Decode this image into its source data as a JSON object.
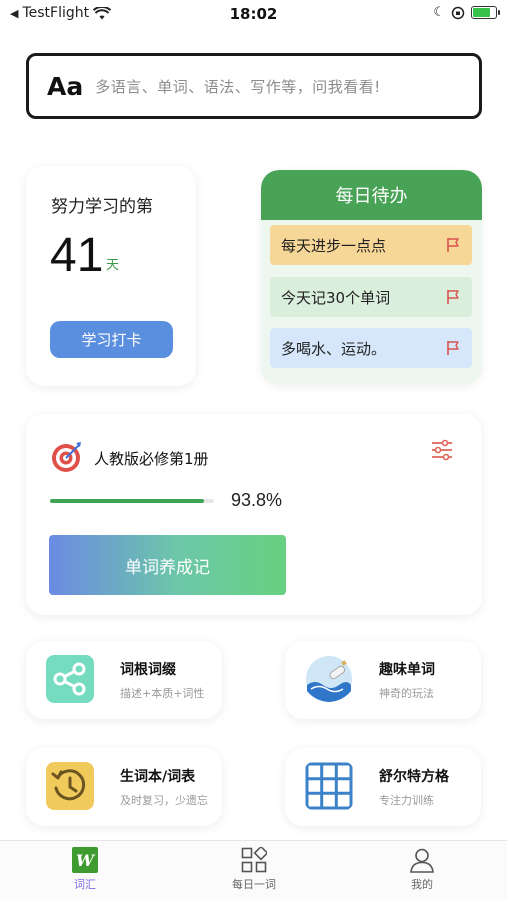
{
  "status_bar": {
    "back_app": "TestFlight",
    "time": "18:02"
  },
  "search": {
    "icon_text": "Aa",
    "placeholder": "多语言、单词、语法、写作等，问我看看!"
  },
  "study": {
    "title": "努力学习的第",
    "days": "41",
    "unit": "天",
    "checkin_label": "学习打卡"
  },
  "todo": {
    "title": "每日待办",
    "items": [
      {
        "label": "每天进步一点点"
      },
      {
        "label": "今天记30个单词"
      },
      {
        "label": "多喝水、运动。"
      }
    ],
    "colors": {
      "item1": "#f6d797",
      "item2": "#daeedc",
      "item3": "#d6e6fb",
      "header": "#49a356"
    }
  },
  "book": {
    "title": "人教版必修第1册",
    "progress": 0.938,
    "progress_label": "93.8%",
    "action_label": "单词养成记"
  },
  "features": [
    {
      "title": "词根词缀",
      "subtitle": "描述+本质+词性",
      "icon": "share-icon"
    },
    {
      "title": "趣味单词",
      "subtitle": "神奇的玩法",
      "icon": "bottle-wave-icon"
    },
    {
      "title": "生词本/词表",
      "subtitle": "及时复习，少遗忘",
      "icon": "history-icon"
    },
    {
      "title": "舒尔特方格",
      "subtitle": "专注力训练",
      "icon": "grid-icon"
    }
  ],
  "tabs": [
    {
      "label": "词汇",
      "active": true,
      "icon": "w-logo-icon"
    },
    {
      "label": "每日一词",
      "active": false,
      "icon": "apps-icon"
    },
    {
      "label": "我的",
      "active": false,
      "icon": "user-icon"
    }
  ],
  "colors": {
    "accent_blue": "#5a8fdf",
    "accent_green": "#49a356",
    "tab_active": "#7c6fe0"
  }
}
